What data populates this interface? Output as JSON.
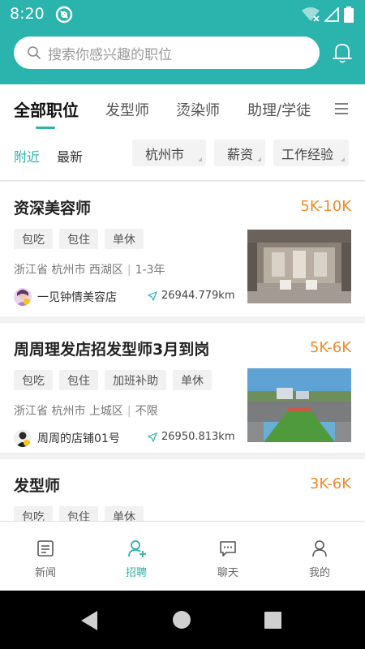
{
  "status": {
    "time": "8:20"
  },
  "search": {
    "placeholder": "搜索你感兴趣的职位"
  },
  "tabs": [
    {
      "label": "全部职位",
      "active": true
    },
    {
      "label": "发型师"
    },
    {
      "label": "烫染师"
    },
    {
      "label": "助理/学徒"
    }
  ],
  "sort": [
    {
      "label": "附近",
      "active": true
    },
    {
      "label": "最新"
    }
  ],
  "filters": [
    {
      "label": "杭州市"
    },
    {
      "label": "薪资"
    },
    {
      "label": "工作经验"
    }
  ],
  "jobs": [
    {
      "title": "资深美容师",
      "salary": "5K-10K",
      "tags": [
        "包吃",
        "包住",
        "单休"
      ],
      "location": "浙江省 杭州市 西湖区",
      "experience": "1-3年",
      "store": "一见钟情美容店",
      "distance": "26944.779km"
    },
    {
      "title": "周周理发店招发型师3月到岗",
      "salary": "5K-6K",
      "tags": [
        "包吃",
        "包住",
        "加班补助",
        "单休"
      ],
      "location": "浙江省 杭州市 上城区",
      "experience": "不限",
      "store": "周周的店铺01号",
      "distance": "26950.813km"
    },
    {
      "title": "发型师",
      "salary": "3K-6K",
      "tags": [
        "包吃",
        "包住",
        "单休"
      ]
    }
  ],
  "nav": [
    {
      "label": "新闻",
      "icon": "news-icon"
    },
    {
      "label": "招聘",
      "icon": "recruit-icon",
      "active": true
    },
    {
      "label": "聊天",
      "icon": "chat-icon"
    },
    {
      "label": "我的",
      "icon": "profile-icon"
    }
  ],
  "colors": {
    "accent": "#2bb3ae",
    "salary": "#f08a2b"
  }
}
